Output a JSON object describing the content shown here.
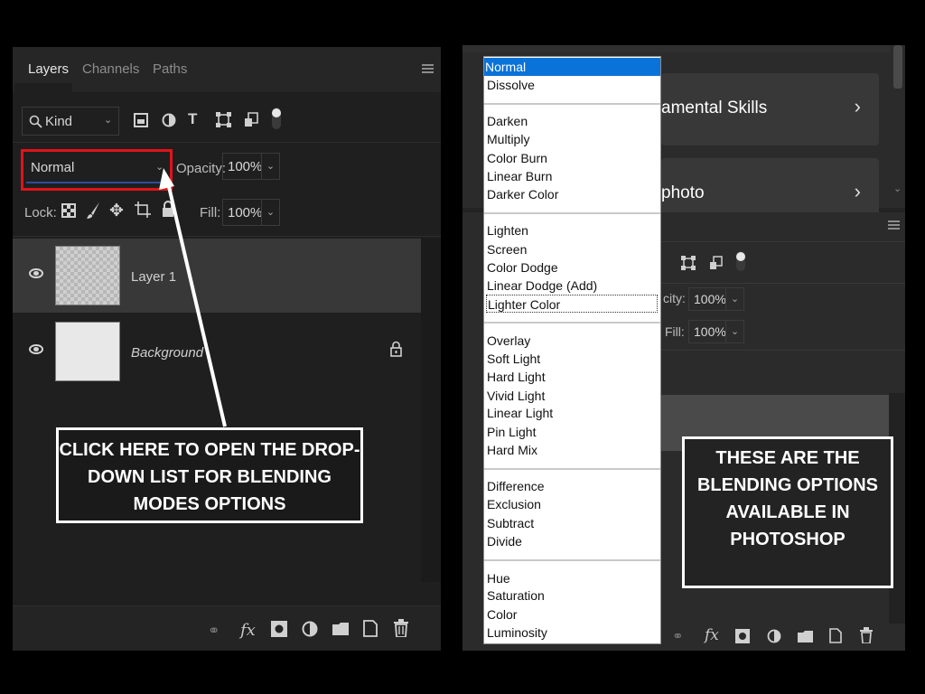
{
  "layers_panel": {
    "tabs": [
      "Layers",
      "Channels",
      "Paths"
    ],
    "filter_kind": "Kind",
    "blend_mode": "Normal",
    "opacity_label": "Opacity:",
    "opacity_value": "100%",
    "lock_label": "Lock:",
    "fill_label": "Fill:",
    "fill_value": "100%",
    "layers": [
      "Layer 1",
      "Background"
    ]
  },
  "left_callout": "CLICK HERE TO OPEN THE DROP-DOWN LIST FOR BLENDING MODES OPTIONS",
  "right_callout": "THESE ARE THE BLENDING OPTIONS AVAILABLE IN PHOTOSHOP",
  "background_cards": [
    "amental Skills",
    "photo"
  ],
  "background_panel": {
    "opacity_partial_label": "city:",
    "opacity_value": "100%",
    "fill_label": "Fill:",
    "fill_value": "100%"
  },
  "blend_groups": [
    [
      "Normal",
      "Dissolve"
    ],
    [
      "Darken",
      "Multiply",
      "Color Burn",
      "Linear Burn",
      "Darker Color"
    ],
    [
      "Lighten",
      "Screen",
      "Color Dodge",
      "Linear Dodge (Add)",
      "Lighter Color"
    ],
    [
      "Overlay",
      "Soft Light",
      "Hard Light",
      "Vivid Light",
      "Linear Light",
      "Pin Light",
      "Hard Mix"
    ],
    [
      "Difference",
      "Exclusion",
      "Subtract",
      "Divide"
    ],
    [
      "Hue",
      "Saturation",
      "Color",
      "Luminosity"
    ]
  ],
  "selected_mode": "Normal",
  "hovered_mode": "Lighter Color",
  "colors": {
    "highlight_border": "#e1131a",
    "selection_blue": "#0a73d9"
  }
}
